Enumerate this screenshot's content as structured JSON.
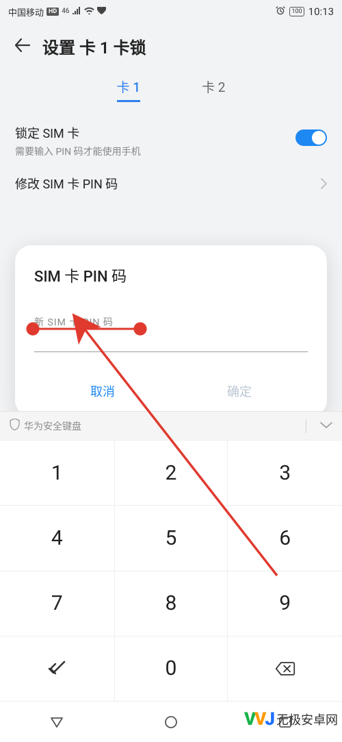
{
  "status": {
    "carrier": "中国移动",
    "hd": "HD",
    "net": "46",
    "battery": "100",
    "time": "10:13"
  },
  "header": {
    "title": "设置 卡 1 卡锁"
  },
  "tabs": [
    {
      "label": "卡 1",
      "active": true
    },
    {
      "label": "卡 2",
      "active": false
    }
  ],
  "settings": {
    "lock_title": "锁定 SIM 卡",
    "lock_sub": "需要输入 PIN 码才能使用手机",
    "lock_on": true,
    "change_pin": "修改 SIM 卡 PIN 码"
  },
  "dialog": {
    "title": "SIM 卡 PIN 码",
    "field_label": "新 SIM 卡 PIN 码",
    "value": "",
    "cancel": "取消",
    "ok": "确定"
  },
  "keyboard": {
    "name": "华为安全键盘",
    "keys": [
      "1",
      "2",
      "3",
      "4",
      "5",
      "6",
      "7",
      "8",
      "9"
    ],
    "zero": "0"
  },
  "watermark": {
    "text": "无极安卓网"
  }
}
